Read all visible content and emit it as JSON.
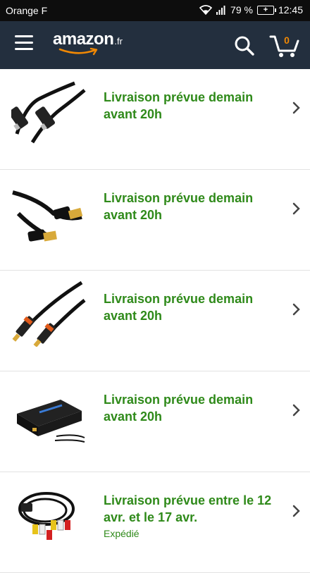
{
  "status_bar": {
    "carrier": "Orange F",
    "battery_percent": "79 %",
    "battery_icon_label": "+",
    "time": "12:45"
  },
  "header": {
    "logo_text": "amazon",
    "logo_tld": ".fr",
    "cart_count": "0",
    "colors": {
      "background": "#232f3e",
      "cart_count": "#f08804"
    }
  },
  "orders": [
    {
      "product": "optical-audio-cable",
      "delivery": "Livraison prévue demain avant 20h",
      "status": ""
    },
    {
      "product": "hdmi-cable",
      "delivery": "Livraison prévue demain avant 20h",
      "status": ""
    },
    {
      "product": "rca-audio-cable",
      "delivery": "Livraison prévue demain avant 20h",
      "status": ""
    },
    {
      "product": "audio-converter-box",
      "delivery": "Livraison prévue demain avant 20h",
      "status": ""
    },
    {
      "product": "av-composite-cable",
      "delivery": "Livraison prévue entre le 12 avr. et le 17 avr.",
      "status": "Expédié"
    }
  ],
  "colors": {
    "delivery_text": "#2f8a1a",
    "divider": "#e2e2e2"
  }
}
